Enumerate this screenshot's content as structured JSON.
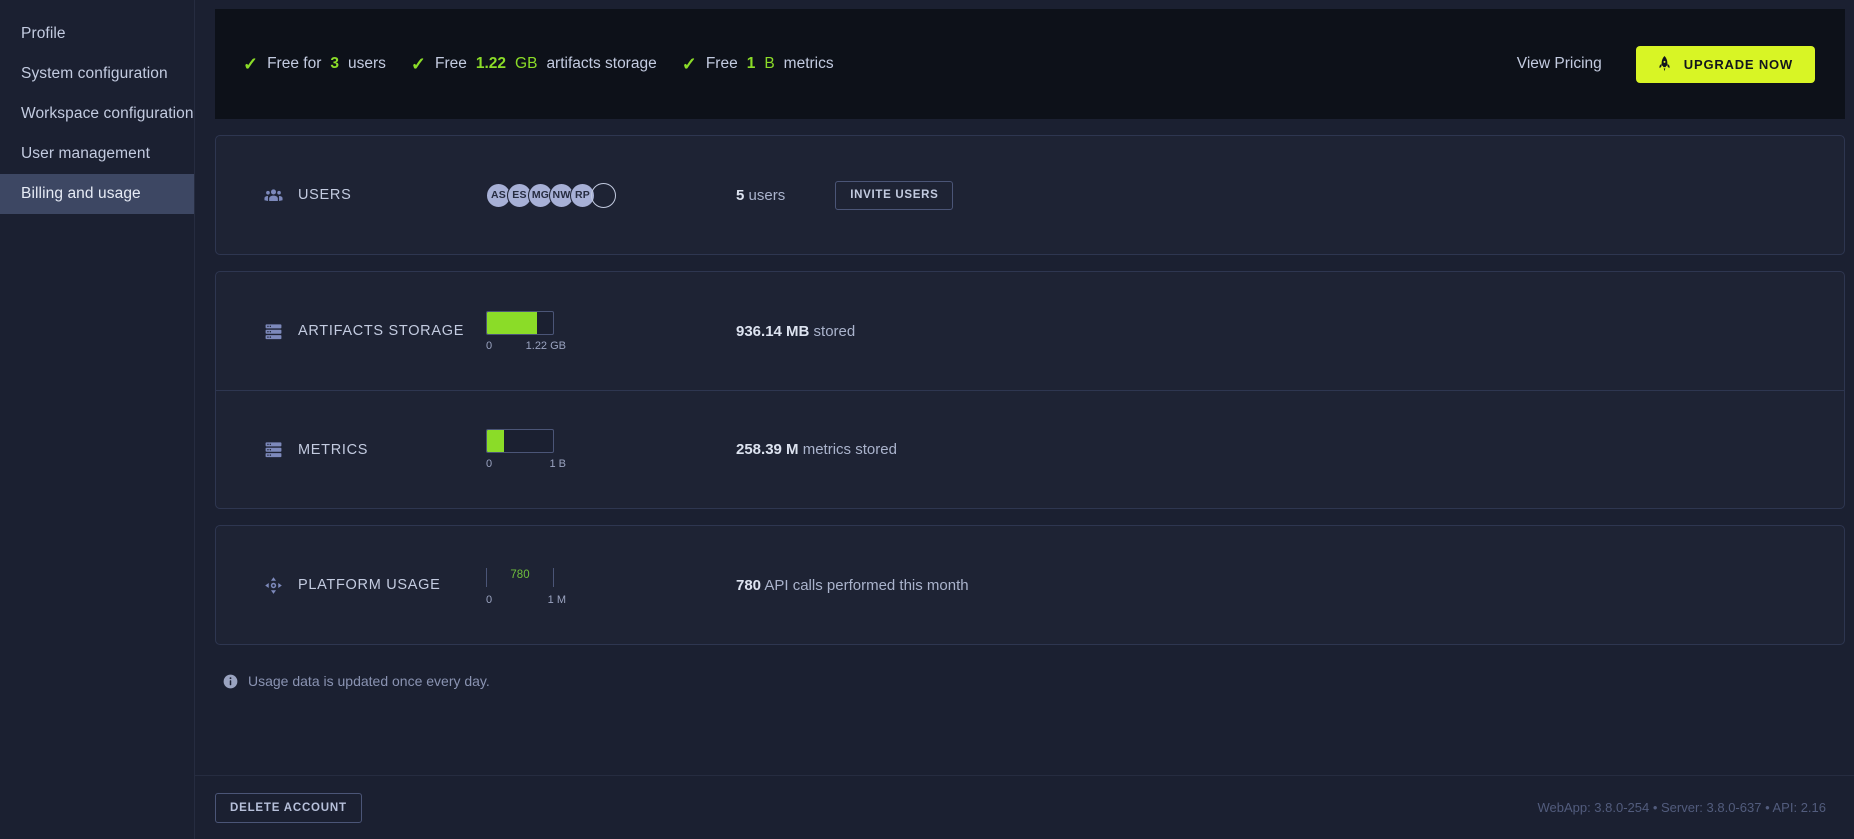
{
  "sidebar": {
    "items": [
      {
        "label": "Profile",
        "active": false
      },
      {
        "label": "System configuration",
        "active": false
      },
      {
        "label": "Workspace configuration",
        "active": false
      },
      {
        "label": "User management",
        "active": false
      },
      {
        "label": "Billing and usage",
        "active": true
      }
    ]
  },
  "banner": {
    "perks": [
      {
        "prefix": "Free for",
        "value": "3",
        "suffix": "users",
        "unit": ""
      },
      {
        "prefix": "Free",
        "value": "1.22",
        "unit": "GB",
        "suffix": "artifacts storage"
      },
      {
        "prefix": "Free",
        "value": "1",
        "unit": "B",
        "suffix": "metrics"
      }
    ],
    "view_pricing": "View Pricing",
    "upgrade_label": "UPGRADE NOW",
    "upgrade_icon": "rocket-icon",
    "accent": "#d8f525",
    "check_color": "#8bdc28"
  },
  "users_row": {
    "title": "USERS",
    "icon": "people-icon",
    "avatars": [
      "AS",
      "ES",
      "MG",
      "NW",
      "RP"
    ],
    "add_avatar": "add-user-circle",
    "count": "5",
    "count_suffix": "users",
    "invite_label": "INVITE USERS"
  },
  "artifacts_row": {
    "title": "ARTIFACTS STORAGE",
    "icon": "storage-icon",
    "gauge": {
      "percent": 75,
      "min_label": "0",
      "max_label": "1.22 GB",
      "fill_color": "#8bdc28"
    },
    "value": "936.14 MB",
    "value_suffix": "stored"
  },
  "metrics_row": {
    "title": "METRICS",
    "icon": "storage-icon",
    "gauge": {
      "percent": 26,
      "min_label": "0",
      "max_label": "1 B",
      "fill_color": "#8bdc28"
    },
    "value": "258.39 M",
    "value_suffix": "metrics stored"
  },
  "platform_row": {
    "title": "PLATFORM USAGE",
    "icon": "move-arrows-icon",
    "meter": {
      "marker_label": "780",
      "min_label": "0",
      "max_label": "1 M",
      "marker_color": "#6fbf3d"
    },
    "value": "780",
    "value_suffix": "API calls performed this month"
  },
  "note": {
    "icon": "info-icon",
    "text": "Usage data is updated once every day."
  },
  "footer": {
    "delete_label": "DELETE ACCOUNT",
    "versions": "WebApp: 3.8.0-254 • Server: 3.8.0-637 • API: 2.16"
  }
}
